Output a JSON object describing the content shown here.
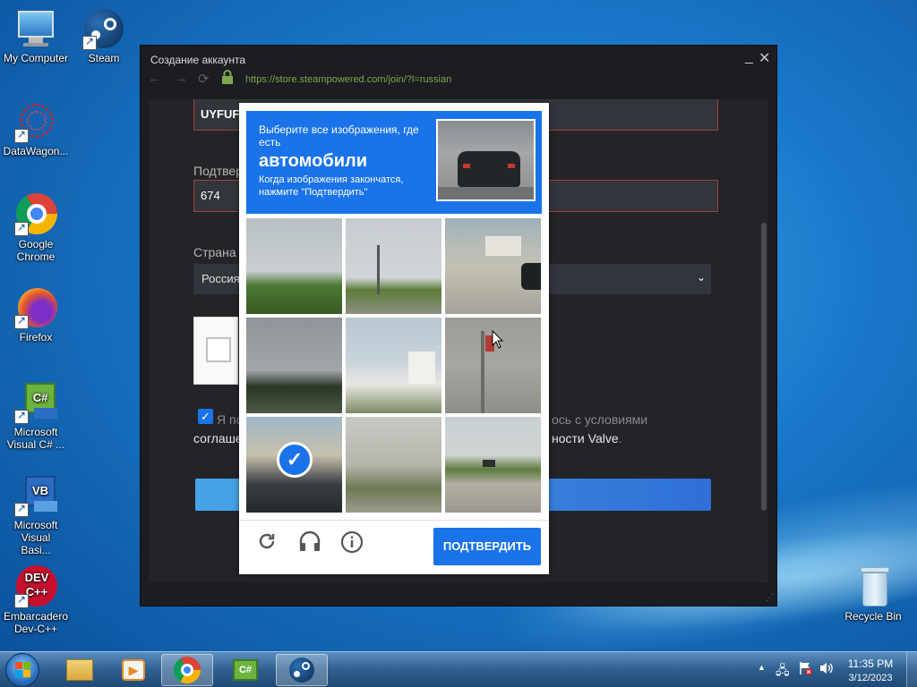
{
  "desktop": {
    "icons": [
      {
        "label": "My Computer"
      },
      {
        "label": "Steam"
      },
      {
        "label": "DataWagon..."
      },
      {
        "label": "Google Chrome"
      },
      {
        "label": "Firefox"
      },
      {
        "label": "Microsoft Visual C# ..."
      },
      {
        "label": "Microsoft Visual Basi..."
      },
      {
        "label": "Embarcadero Dev-C++"
      },
      {
        "label": "Recycle Bin"
      }
    ]
  },
  "window": {
    "title": "Создание аккаунта",
    "url": "https://store.steampowered.com/join/?l=russian",
    "form": {
      "email_value": "UYFUFY",
      "confirm_label": "Подтвер",
      "confirm_value": "674",
      "country_label": "Страна",
      "country_value": "Россия",
      "agree_text_left": "Я по",
      "agree_text_right": "ось с условиями",
      "agree_line2_left": "соглаше",
      "agree_line2_right": "ности Valve",
      "agree_line2_end": "."
    }
  },
  "captcha": {
    "prompt_line1": "Выберите все изображения, где",
    "prompt_line2": "есть",
    "target": "автомобили",
    "instruction_line1": "Когда изображения закончатся,",
    "instruction_line2": "нажмите \"Подтвердить\"",
    "verify_label": "ПОДТВЕРДИТЬ",
    "tiles_selected": [
      false,
      false,
      false,
      false,
      false,
      false,
      true,
      false,
      false
    ]
  },
  "taskbar": {
    "time": "11:35 PM",
    "date": "3/12/2023"
  },
  "colors": {
    "captcha_accent": "#1a73e8",
    "steam_bg": "#1b1d22",
    "error_border": "#a3423c"
  }
}
